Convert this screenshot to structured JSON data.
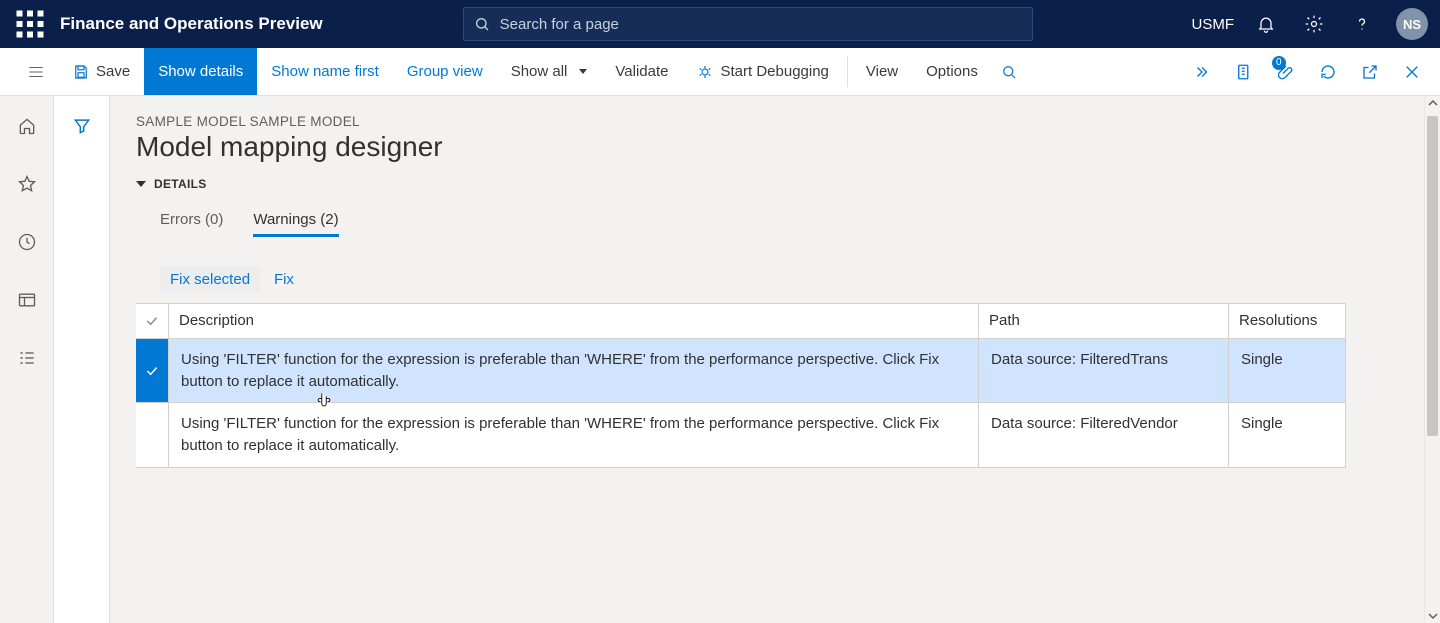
{
  "brand_title": "Finance and Operations Preview",
  "search_placeholder": "Search for a page",
  "environment": "USMF",
  "avatar_initials": "NS",
  "attachment_badge": "0",
  "commands": {
    "save": "Save",
    "show_details": "Show details",
    "show_name_first": "Show name first",
    "group_view": "Group view",
    "show_all": "Show all",
    "validate": "Validate",
    "start_debugging": "Start Debugging",
    "view": "View",
    "options": "Options"
  },
  "breadcrumb": "SAMPLE MODEL SAMPLE MODEL",
  "page_title": "Model mapping designer",
  "details_label": "DETAILS",
  "tabs": {
    "errors": "Errors (0)",
    "warnings": "Warnings (2)"
  },
  "row_actions": {
    "fix_selected": "Fix selected",
    "fix": "Fix"
  },
  "columns": {
    "description": "Description",
    "path": "Path",
    "resolutions": "Resolutions"
  },
  "rows": [
    {
      "selected": true,
      "description": "Using 'FILTER' function for the expression is preferable than 'WHERE' from the performance perspective. Click Fix button to replace it automatically.",
      "path": "Data source: FilteredTrans",
      "resolutions": "Single"
    },
    {
      "selected": false,
      "description": "Using 'FILTER' function for the expression is preferable than 'WHERE' from the performance perspective. Click Fix button to replace it automatically.",
      "path": "Data source: FilteredVendor",
      "resolutions": "Single"
    }
  ]
}
